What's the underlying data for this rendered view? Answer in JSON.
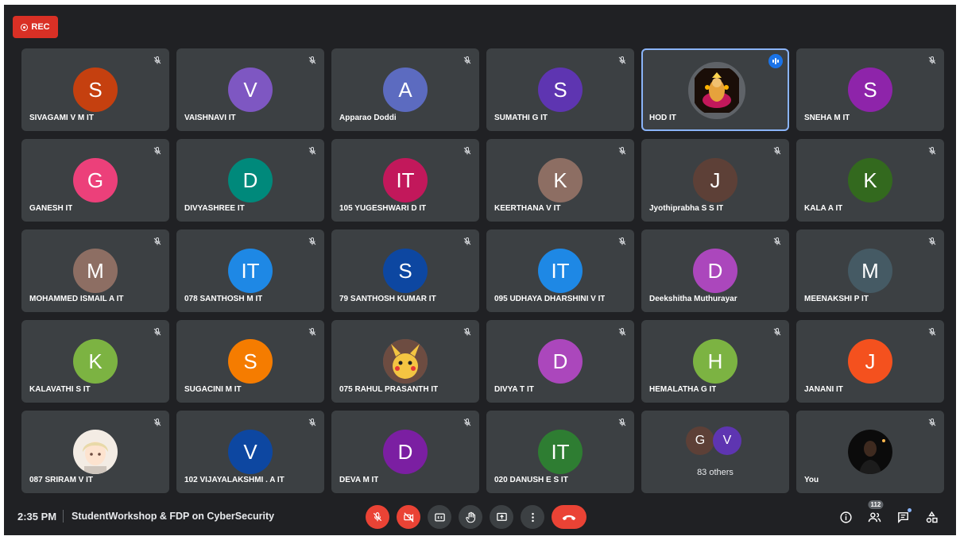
{
  "recording": {
    "label": "REC"
  },
  "participants": [
    {
      "name": "SIVAGAMI V M IT",
      "initial": "S",
      "color": "#c5400f",
      "muted": true
    },
    {
      "name": "VAISHNAVI IT",
      "initial": "V",
      "color": "#7e57c2",
      "muted": true
    },
    {
      "name": "Apparao Doddi",
      "initial": "A",
      "color": "#5c6bc0",
      "muted": true
    },
    {
      "name": "SUMATHI G IT",
      "initial": "S",
      "color": "#5e35b1",
      "muted": true
    },
    {
      "name": "HOD IT",
      "initial": "",
      "color": "#5f6368",
      "muted": false,
      "speaking": true,
      "photo": "goddess-photo",
      "active": true
    },
    {
      "name": "SNEHA M IT",
      "initial": "S",
      "color": "#8e24aa",
      "muted": true
    },
    {
      "name": "GANESH IT",
      "initial": "G",
      "color": "#ec407a",
      "muted": true
    },
    {
      "name": "DIVYASHREE IT",
      "initial": "D",
      "color": "#00897b",
      "muted": true
    },
    {
      "name": "105 YUGESHWARI D IT",
      "initial": "IT",
      "color": "#c2185b",
      "muted": true
    },
    {
      "name": "KEERTHANA V IT",
      "initial": "K",
      "color": "#8d6e63",
      "muted": true
    },
    {
      "name": "Jyothiprabha S S IT",
      "initial": "J",
      "color": "#5d4037",
      "muted": true
    },
    {
      "name": "KALA A IT",
      "initial": "K",
      "color": "#33691e",
      "muted": true
    },
    {
      "name": "MOHAMMED ISMAIL A IT",
      "initial": "M",
      "color": "#8d6e63",
      "muted": true
    },
    {
      "name": "078 SANTHOSH M IT",
      "initial": "IT",
      "color": "#1e88e5",
      "muted": true
    },
    {
      "name": "79 SANTHOSH KUMAR IT",
      "initial": "S",
      "color": "#0d47a1",
      "muted": true
    },
    {
      "name": "095 UDHAYA DHARSHINI V IT",
      "initial": "IT",
      "color": "#1e88e5",
      "muted": true
    },
    {
      "name": "Deekshitha Muthurayar",
      "initial": "D",
      "color": "#ab47bc",
      "muted": true
    },
    {
      "name": "MEENAKSHI P IT",
      "initial": "M",
      "color": "#455a64",
      "muted": true
    },
    {
      "name": "KALAVATHI S IT",
      "initial": "K",
      "color": "#7cb342",
      "muted": true
    },
    {
      "name": "SUGACINI M IT",
      "initial": "S",
      "color": "#f57c00",
      "muted": true
    },
    {
      "name": "075 RAHUL PRASANTH IT",
      "initial": "",
      "color": "#5f6368",
      "muted": true,
      "photo": "pikachu-photo"
    },
    {
      "name": "DIVYA T IT",
      "initial": "D",
      "color": "#ab47bc",
      "muted": true
    },
    {
      "name": "HEMALATHA G IT",
      "initial": "H",
      "color": "#7cb342",
      "muted": true
    },
    {
      "name": "JANANI IT",
      "initial": "J",
      "color": "#f4511e",
      "muted": true
    },
    {
      "name": "087 SRIRAM V IT",
      "initial": "",
      "color": "#e8d8c8",
      "muted": true,
      "photo": "anime-photo"
    },
    {
      "name": "102 VIJAYALAKSHMI . A IT",
      "initial": "V",
      "color": "#0d47a1",
      "muted": true
    },
    {
      "name": "DEVA M IT",
      "initial": "D",
      "color": "#7b1fa2",
      "muted": true
    },
    {
      "name": "020 DANUSH E S IT",
      "initial": "IT",
      "color": "#2e7d32",
      "muted": true
    }
  ],
  "others_tile": {
    "avatars": [
      {
        "initial": "G",
        "color": "#5d4037"
      },
      {
        "initial": "V",
        "color": "#5e35b1"
      }
    ],
    "label": "83 others"
  },
  "self_tile": {
    "name": "You",
    "photo": "night-photo",
    "muted": true
  },
  "bottom_bar": {
    "time": "2:35 PM",
    "meeting_title": "StudentWorkshop & FDP on CyberSecurity",
    "controls": [
      "mic-off-icon",
      "camera-off-icon",
      "captions-icon",
      "raise-hand-icon",
      "present-icon",
      "more-options-icon",
      "hang-up-icon"
    ],
    "people_count": "112",
    "accent": "#ea4335"
  }
}
